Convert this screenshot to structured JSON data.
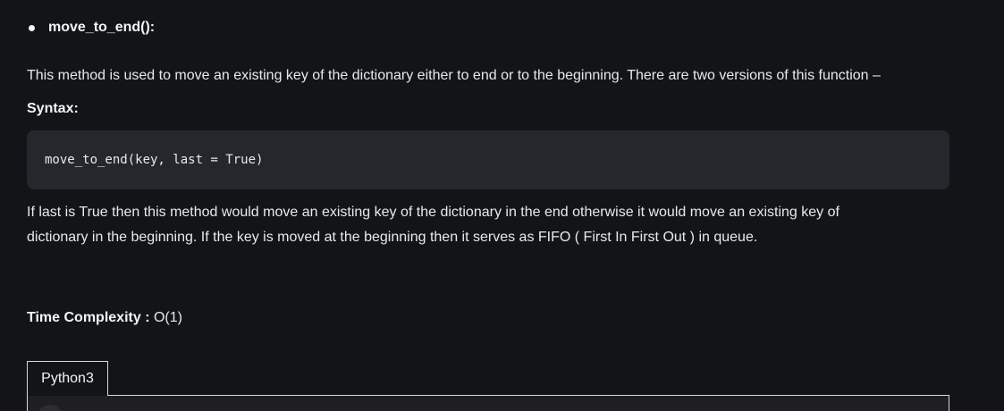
{
  "method": {
    "name": "move_to_end():"
  },
  "description": "This method is used to move an existing key of the dictionary either to end or to the beginning. There are two versions of this function –",
  "syntax": {
    "heading": "Syntax:",
    "code": "move_to_end(key, last = True)"
  },
  "explanation": {
    "line1": "If last is True then this method would move an existing key of the dictionary in the end otherwise it would move an existing key of",
    "line2": "dictionary in the beginning. If the key is moved at the beginning then it serves as FIFO ( First In First Out ) in queue."
  },
  "complexity": {
    "label": "Time Complexity :",
    "value": " O(1)"
  },
  "tabs": [
    {
      "label": "Python3",
      "active": true
    }
  ],
  "colors": {
    "background": "#131417",
    "code_background": "#26272c",
    "text": "#e8e9ec"
  }
}
